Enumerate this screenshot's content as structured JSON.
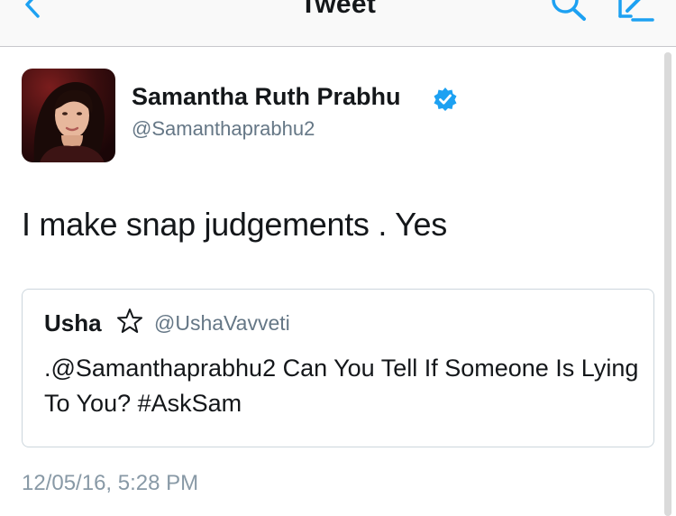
{
  "navbar": {
    "title": "Tweet",
    "back_icon": "chevron-left-icon",
    "search_icon": "search-icon",
    "compose_icon": "compose-icon",
    "accent_color": "#1da1f2"
  },
  "tweet": {
    "author": {
      "name": "Samantha Ruth Prabhu",
      "handle": "@Samanthaprabhu2",
      "verified": true,
      "verified_icon": "verified-badge-icon",
      "verified_color": "#1da1f2"
    },
    "text": "I make snap judgements . Yes",
    "quoted": {
      "name": "Usha",
      "name_icon": "star-outline-icon",
      "handle": "@UshaVavveti",
      "text": ".@Samanthaprabhu2 Can You Tell If Someone Is Lying To You? #AskSam"
    },
    "timestamp": "12/05/16, 5:28 PM"
  }
}
